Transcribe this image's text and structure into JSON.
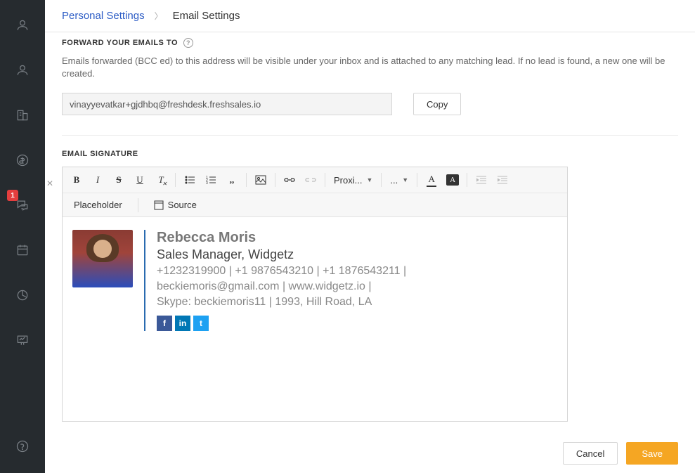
{
  "sidebar": {
    "badge": "1"
  },
  "breadcrumb": {
    "parent": "Personal Settings",
    "current": "Email Settings"
  },
  "forward": {
    "title": "FORWARD YOUR EMAILS TO",
    "desc": "Emails forwarded (BCC ed) to this address will be visible under your inbox and is attached to any matching lead. If no lead is found, a new one will be created.",
    "value": "vinayyevatkar+gjdhbq@freshdesk.freshsales.io",
    "copy": "Copy"
  },
  "signature": {
    "title": "EMAIL SIGNATURE",
    "placeholder_btn": "Placeholder",
    "source_btn": "Source",
    "font_family": "Proxi...",
    "font_size": "...",
    "name": "Rebecca Moris",
    "role": "Sales Manager, Widgetz",
    "phones": "+1232319900 | +1 9876543210 | +1 1876543211 |",
    "contact": "beckiemoris@gmail.com | www.widgetz.io |",
    "address": "Skype: beckiemoris11 | 1993, Hill Road, LA"
  },
  "footer": {
    "cancel": "Cancel",
    "save": "Save"
  }
}
